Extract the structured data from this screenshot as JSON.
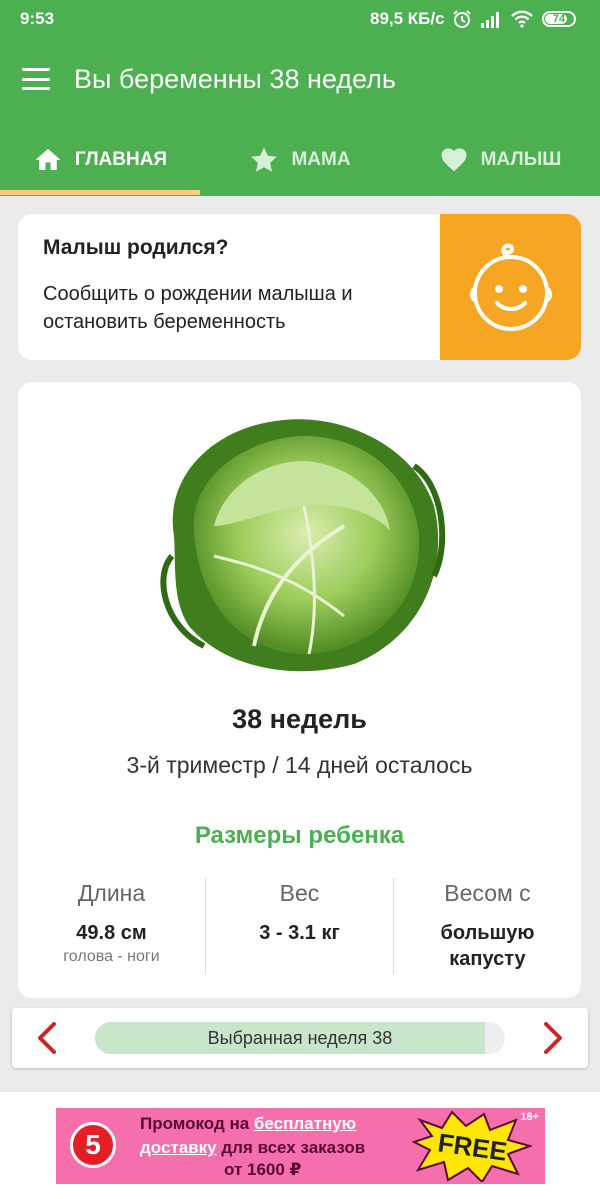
{
  "status_bar": {
    "time": "9:53",
    "network_speed": "89,5 КБ/с",
    "battery": "74"
  },
  "app_bar": {
    "title": "Вы беременны 38 недель"
  },
  "tabs": [
    {
      "label": "ГЛАВНАЯ",
      "icon": "home-icon",
      "active": true
    },
    {
      "label": "МАМА",
      "icon": "star-icon",
      "active": false
    },
    {
      "label": "МАЛЫШ",
      "icon": "heart-icon",
      "active": false
    }
  ],
  "baby_born_card": {
    "question": "Малыш родился?",
    "description": "Сообщить о рождении малыша и остановить беременность",
    "icon": "baby-face-icon"
  },
  "week_card": {
    "image": "cabbage-image",
    "week_title": "38 недель",
    "subtitle": "3-й триместр / 14 дней осталось",
    "sizes_title": "Размеры ребенка",
    "stats": [
      {
        "label": "Длина",
        "value": "49.8 см",
        "note": "голова - ноги"
      },
      {
        "label": "Вес",
        "value": "3 - 3.1 кг",
        "note": ""
      },
      {
        "label": "Весом с",
        "value": "большую капусту",
        "note": ""
      }
    ]
  },
  "week_nav": {
    "label": "Выбранная неделя 38",
    "progress": 0.95
  },
  "ad": {
    "logo": "5",
    "line1_prefix": "Промокод на",
    "line1_link": "бесплатную",
    "line2_link": "доставку",
    "line2_suffix": "для всех заказов",
    "line3": "от 1600 ₽",
    "badge": "FREE",
    "age": "18+"
  },
  "colors": {
    "primary": "#4caf50",
    "accent_orange": "#f6a623",
    "nav_arrow": "#c62828",
    "ad_pink": "#f56fad"
  }
}
